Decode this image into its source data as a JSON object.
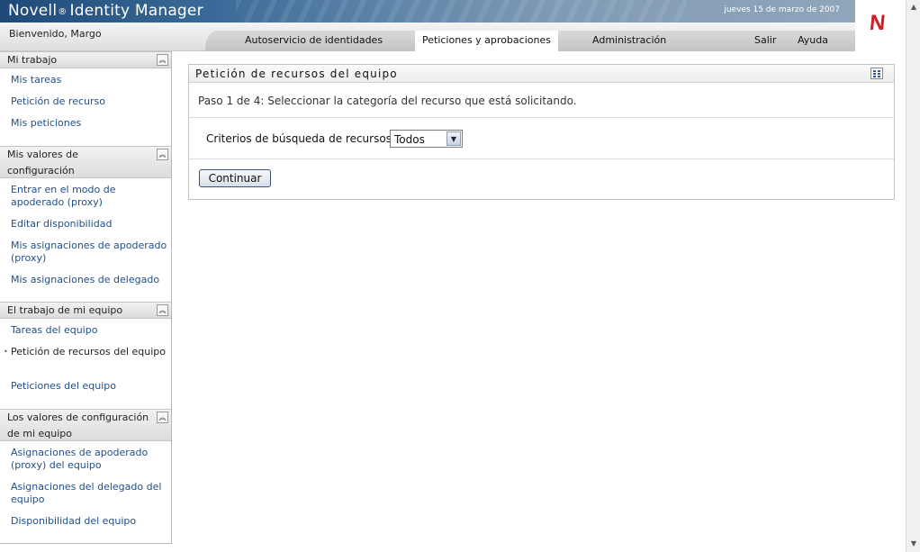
{
  "header": {
    "brand": "Novell",
    "reg": "®",
    "product": "Identity Manager",
    "date": "jueves 15 de marzo de 2007",
    "welcome": "Bienvenido, Margo",
    "logo_letter": "N"
  },
  "nav": {
    "tabs": [
      {
        "label": "Autoservicio de identidades",
        "active": false
      },
      {
        "label": "Peticiones y aprobaciones",
        "active": true
      },
      {
        "label": "Administración",
        "active": false
      }
    ],
    "logout": "Salir",
    "help": "Ayuda"
  },
  "sidebar": {
    "sections": [
      {
        "title": "Mi trabajo",
        "items": [
          "Mis tareas",
          "Petición de recurso",
          "Mis peticiones"
        ]
      },
      {
        "title": "Mis valores de configuración",
        "items": [
          "Entrar en el modo de apoderado (proxy)",
          "Editar disponibilidad",
          "Mis asignaciones de apoderado (proxy)",
          "Mis asignaciones de delegado"
        ]
      },
      {
        "title": "El trabajo de mi equipo",
        "items": [
          "Tareas del equipo",
          "Petición de recursos del equipo",
          "Peticiones del equipo"
        ]
      },
      {
        "title": "Los valores de configuración de mi equipo",
        "items": [
          "Asignaciones de apoderado (proxy) del equipo",
          "Asignaciones del delegado del equipo",
          "Disponibilidad del equipo"
        ]
      }
    ],
    "active_bullet": "•"
  },
  "main": {
    "panel_title": "Petición de recursos del equipo",
    "step_text": "Paso 1 de 4: Seleccionar la categoría del recurso que está solicitando.",
    "criteria_label": "Criterios de búsqueda de recursos:",
    "criteria_value": "Todos",
    "continue_label": "Continuar"
  },
  "icons": {
    "collapse": "collapse-up-icon",
    "panel": "layout-grid-icon",
    "dropdown": "chevron-down-icon"
  },
  "colors": {
    "link": "#1f4f8a",
    "brand_red": "#cc1f26",
    "banner": "#3a6b98"
  }
}
